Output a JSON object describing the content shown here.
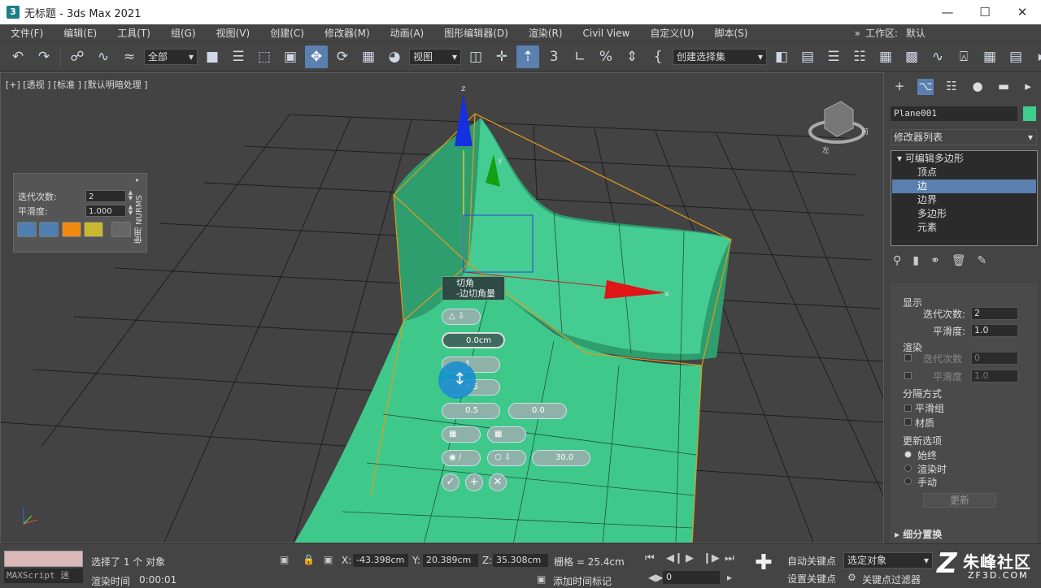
{
  "window": {
    "title": "无标题 - 3ds Max 2021",
    "icon": "3ds-max-icon"
  },
  "menu": [
    "文件(F)",
    "编辑(E)",
    "工具(T)",
    "组(G)",
    "视图(V)",
    "创建(C)",
    "修改器(M)",
    "动画(A)",
    "图形编辑器(D)",
    "渲染(R)",
    "Civil View",
    "自定义(U)",
    "脚本(S)"
  ],
  "workspace": {
    "label": "工作区:",
    "value": "默认"
  },
  "toolbar": {
    "selection_filter": "全部",
    "ref_coord": "视图",
    "named_selection": "创建选择集"
  },
  "viewport": {
    "label": "[+] [透视 ] [标准 ] [默认明暗处理 ]",
    "axis_z": "z",
    "axis_y": "y",
    "axis_x": "x",
    "viewcube_labels": {
      "left": "左",
      "right": "前"
    }
  },
  "nurms": {
    "iter_label": "迭代次数:",
    "iter_value": "2",
    "smooth_label": "平滑度:",
    "smooth_value": "1.000",
    "side": "使用 NURMS"
  },
  "caddy": {
    "title_line1": "切角",
    "title_line2": "-边切角量",
    "amount": "0.0cm",
    "segments": "1",
    "tension": "0.5",
    "depth": "0.5",
    "end_bias": "0.0",
    "angle": "30.0"
  },
  "command_panel": {
    "object_name": "Plane001",
    "object_color": "#3ecf8e",
    "modifier_list": "修改器列表",
    "stack": {
      "root": "可编辑多边形",
      "items": [
        "顶点",
        "边",
        "边界",
        "多边形",
        "元素"
      ],
      "selected": 1
    },
    "display_title": "显示",
    "display_iter_label": "迭代次数:",
    "display_iter": "2",
    "display_smooth_label": "平滑度:",
    "display_smooth": "1.0",
    "render_title": "渲染",
    "render_iter_label": "迭代次数",
    "render_iter": "0",
    "render_smooth_label": "平滑度",
    "render_smooth": "1.0",
    "sep_title": "分隔方式",
    "sep_smooth": "平滑组",
    "sep_material": "材质",
    "update_title": "更新选项",
    "update_always": "始终",
    "update_render": "渲染时",
    "update_manual": "手动",
    "update_button": "更新",
    "subdiv_title": "细分置换"
  },
  "status": {
    "selected": "选择了 1 个 对象",
    "render_time_label": "渲染时间",
    "render_time": "0:00:01",
    "maxscript": "MAXScript 迷",
    "x_label": "X:",
    "x": "-43.398cm",
    "y_label": "Y:",
    "y": "20.389cm",
    "z_label": "Z:",
    "z": "35.308cm",
    "grid": "栅格 = 25.4cm",
    "add_tag": "添加时间标记",
    "auto_key": "自动关键点",
    "set_key": "设置关键点",
    "selected_objects": "选定对象",
    "key_filter": "关键点过滤器",
    "frame": "0"
  },
  "watermark": {
    "text": "朱峰社区",
    "sub": "ZF3D.COM"
  }
}
